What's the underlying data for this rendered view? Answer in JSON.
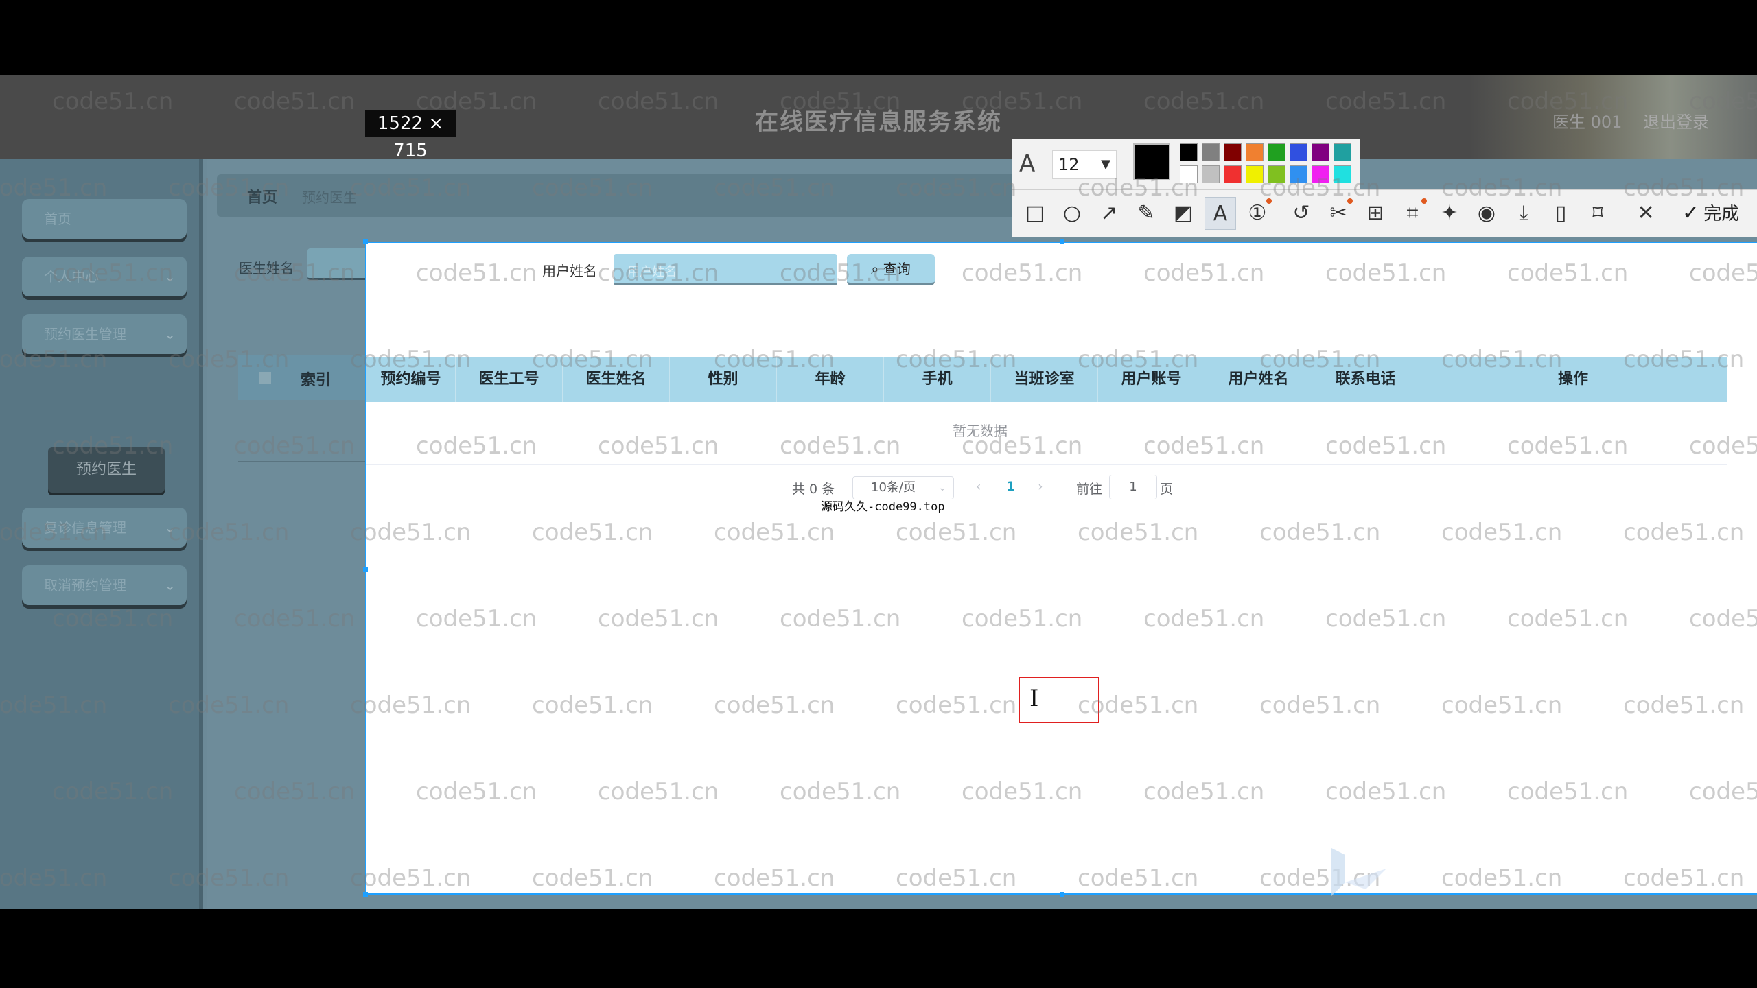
{
  "app": {
    "title": "在线医疗信息服务系统",
    "user": "医生 001",
    "logout": "退出登录"
  },
  "sidebar": {
    "items": [
      {
        "label": "首页",
        "has_arrow": false
      },
      {
        "label": "个人中心",
        "has_arrow": true
      },
      {
        "label": "预约医生管理",
        "has_arrow": true
      },
      {
        "label": "复诊信息管理",
        "has_arrow": true
      },
      {
        "label": "取消预约管理",
        "has_arrow": true
      }
    ],
    "sub_item": "预约医生"
  },
  "breadcrumb": {
    "home": "首页",
    "current": "预约医生"
  },
  "search": {
    "doctor_label": "医生姓名",
    "user_label": "用户姓名",
    "user_placeholder": "用户姓名",
    "query_label": "查询"
  },
  "table": {
    "columns": [
      "索引",
      "预约编号",
      "医生工号",
      "医生姓名",
      "性别",
      "年龄",
      "手机",
      "当班诊室",
      "用户账号",
      "用户姓名",
      "联系电话",
      "操作"
    ],
    "empty_text": "暂无数据"
  },
  "pagination": {
    "total": "共 0 条",
    "page_size": "10条/页",
    "current_page": "1",
    "goto_label": "前往",
    "goto_value": "1",
    "page_suffix": "页"
  },
  "source_note": "源码久久-code99.top",
  "screenshot_tool": {
    "size_label": "1522 × 715",
    "font_size": "12",
    "current_color": "#000000",
    "palette_top": [
      "#000000",
      "#808080",
      "#800000",
      "#f08030",
      "#20a020",
      "#3050e0",
      "#800080",
      "#20a0a0"
    ],
    "palette_bottom": [
      "#ffffff",
      "#c0c0c0",
      "#f03030",
      "#f0f000",
      "#80c020",
      "#3090f0",
      "#f020f0",
      "#20e0e0"
    ],
    "done_label": "完成",
    "tools": [
      "rectangle-icon",
      "ellipse-icon",
      "arrow-icon",
      "pen-icon",
      "mosaic-icon",
      "text-icon",
      "number-icon",
      "undo-icon",
      "crop-icon",
      "translate-icon",
      "ocr-icon",
      "pin-icon",
      "record-icon",
      "download-icon",
      "save-icon",
      "bookmark-icon",
      "close-icon"
    ]
  },
  "watermark": "code51.cn"
}
